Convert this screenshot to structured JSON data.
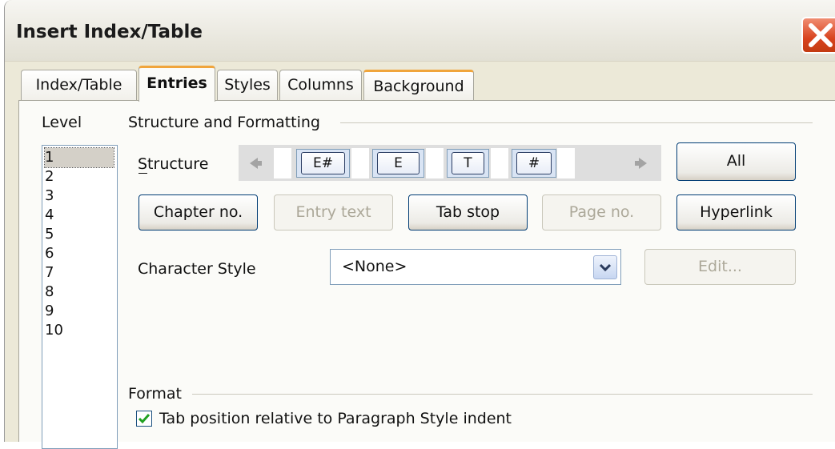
{
  "dialog": {
    "title": "Insert Index/Table"
  },
  "tabs": [
    {
      "label": "Index/Table"
    },
    {
      "label": "Entries"
    },
    {
      "label": "Styles"
    },
    {
      "label": "Columns"
    },
    {
      "label": "Background"
    }
  ],
  "level": {
    "header": "Level",
    "items": [
      "1",
      "2",
      "3",
      "4",
      "5",
      "6",
      "7",
      "8",
      "9",
      "10"
    ],
    "selected": "1"
  },
  "structure": {
    "group_title": "Structure and Formatting",
    "label": "Structure",
    "tokens": [
      "E#",
      "E",
      "T",
      "#"
    ],
    "all_button": "All"
  },
  "buttons": {
    "chapter_no": "Chapter no.",
    "entry_text": "Entry text",
    "tab_stop": "Tab stop",
    "page_no": "Page no.",
    "hyperlink": "Hyperlink",
    "edit": "Edit..."
  },
  "character_style": {
    "label": "Character Style",
    "value": "<None>"
  },
  "format": {
    "group_title": "Format",
    "tab_position_label": "Tab position relative to Paragraph Style indent",
    "tab_position_checked": true
  },
  "icons": {
    "close": "close-icon",
    "scroll_left": "arrow-left-icon",
    "scroll_right": "arrow-right-icon",
    "dropdown": "chevron-down-icon",
    "check": "checkmark-icon"
  },
  "colors": {
    "dialog_bg": "#ece9d8",
    "tab_highlight": "#f0a53c",
    "close_button": "#d8431e",
    "button_border": "#003c74"
  }
}
